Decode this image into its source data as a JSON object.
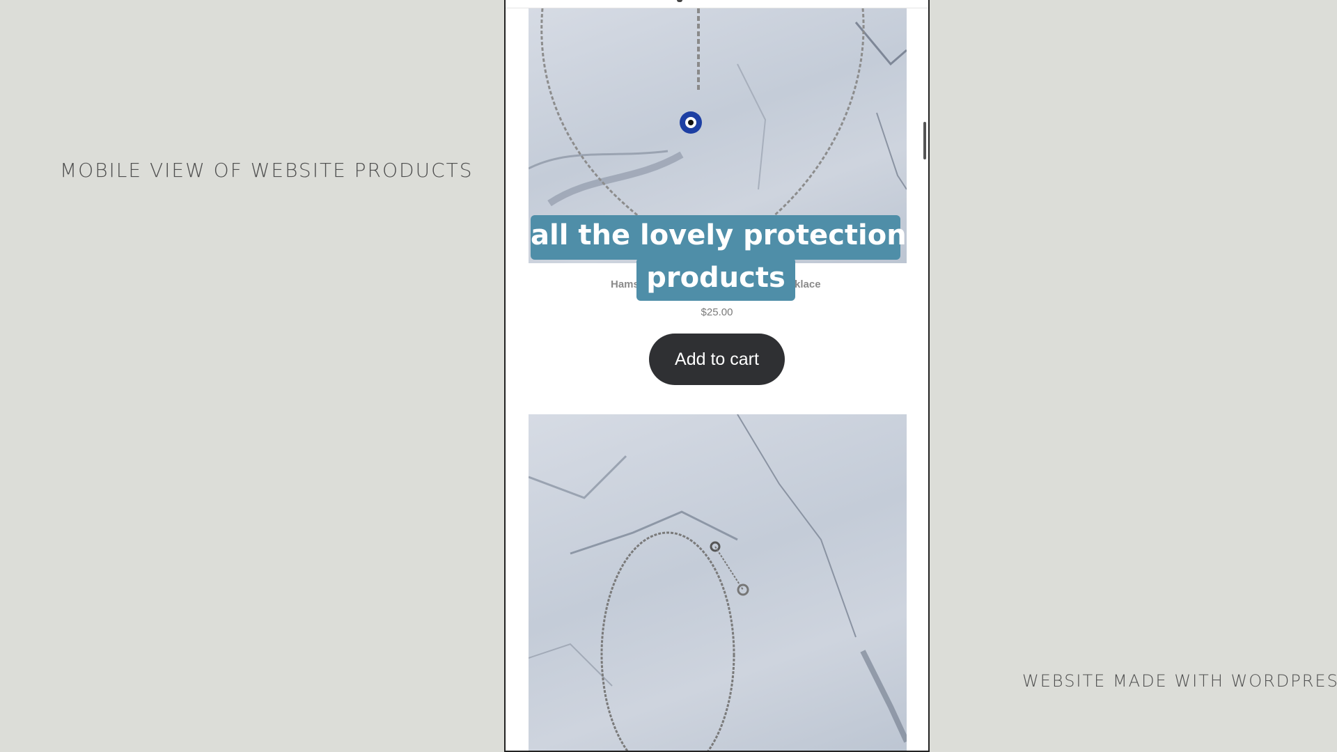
{
  "captions": {
    "left": "Mobile view of website products",
    "right": "Website made with WordPress"
  },
  "product": {
    "title_partial_left": "Hams",
    "title_partial_right": "klace",
    "price": "$25.00",
    "add_to_cart_label": "Add to cart"
  },
  "overlay": {
    "line1": "all the lovely protection",
    "line2": "products"
  },
  "colors": {
    "page_background": "#dcddd8",
    "overlay_accent": "#4f8ea8",
    "button_background": "#2f3033"
  }
}
